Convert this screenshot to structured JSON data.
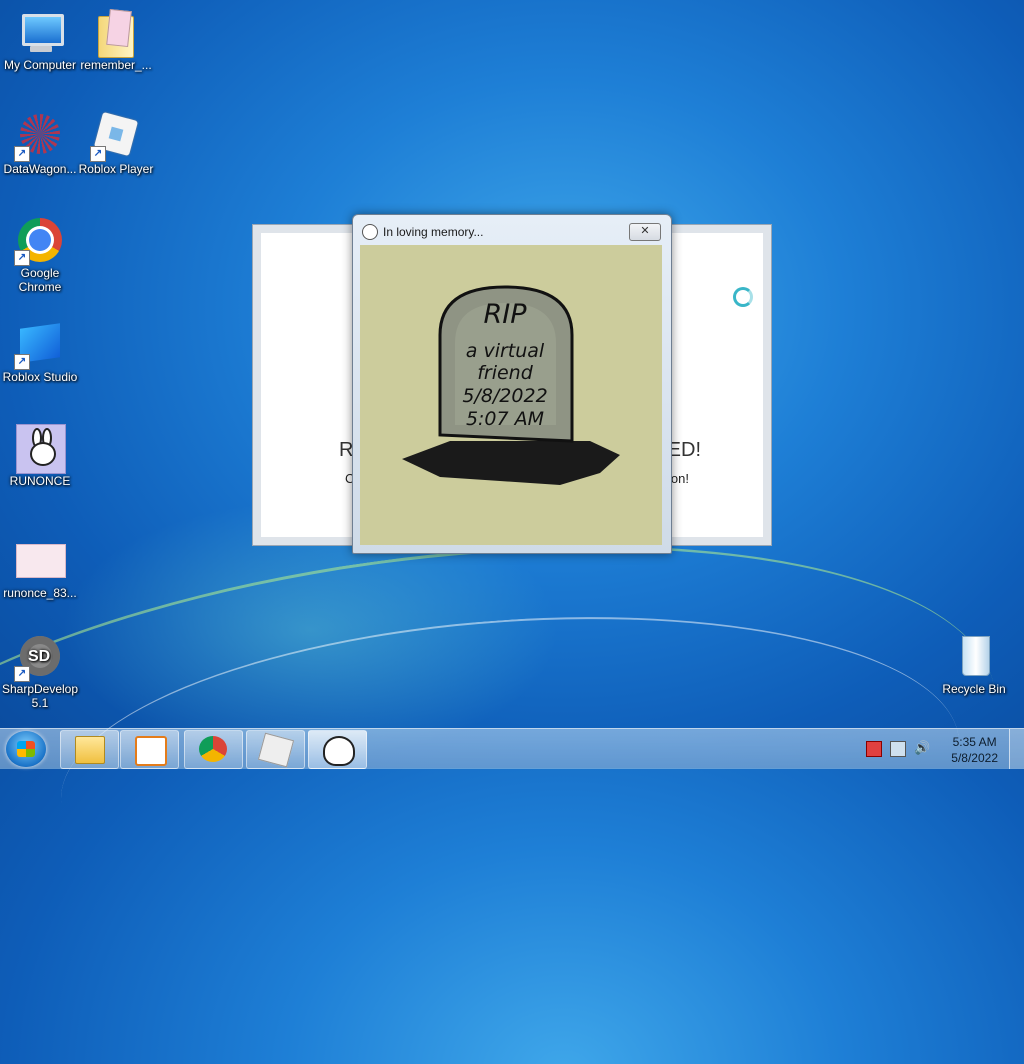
{
  "desktop": {
    "icons": [
      {
        "label": "My Computer"
      },
      {
        "label": "remember_..."
      },
      {
        "label": "DataWagon..."
      },
      {
        "label": "Roblox Player"
      },
      {
        "label": "Google Chrome"
      },
      {
        "label": "Roblox Studio"
      },
      {
        "label": "RUNONCE"
      },
      {
        "label": "runonce_83..."
      },
      {
        "label": "SharpDevelop 5.1"
      },
      {
        "label": "Recycle Bin"
      }
    ]
  },
  "back_window": {
    "text_left": "RC",
    "text_right": "LED!",
    "subtext_left": "C",
    "subtext_right": "on!"
  },
  "dialog": {
    "title": "In loving memory...",
    "close_label": "✕",
    "tombstone": {
      "heading": "RIP",
      "line1": "a virtual",
      "line2": "friend",
      "date": "5/8/2022",
      "time": "5:07 AM"
    }
  },
  "taskbar": {
    "buttons": [
      {
        "icon": "folder-icon"
      },
      {
        "icon": "media-player-icon"
      },
      {
        "icon": "chrome-icon"
      },
      {
        "icon": "roblox-icon"
      },
      {
        "icon": "bunny-icon"
      }
    ],
    "clock_time": "5:35 AM",
    "clock_date": "5/8/2022"
  }
}
